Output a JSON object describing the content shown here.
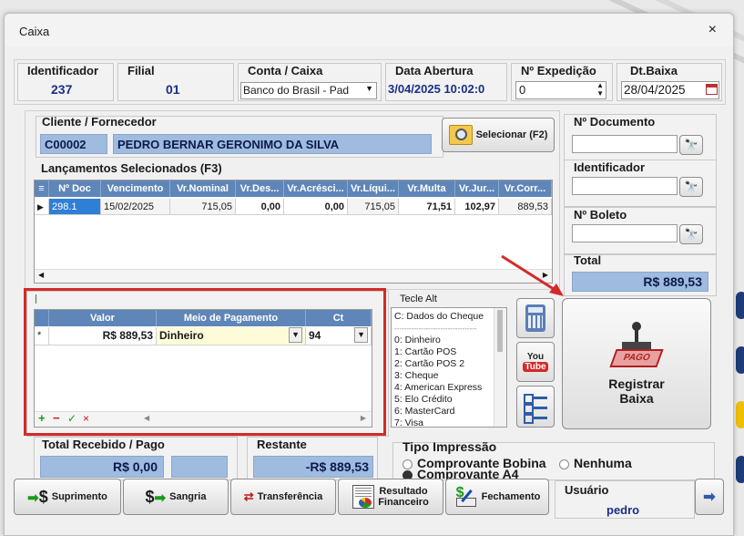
{
  "window": {
    "title": "Caixa",
    "close_glyph": "×"
  },
  "header": {
    "identificador": {
      "label": "Identificador",
      "value": "237"
    },
    "filial": {
      "label": "Filial",
      "value": "01"
    },
    "conta_caixa": {
      "label": "Conta / Caixa",
      "value": "Banco do Brasil - Pad"
    },
    "data_abertura": {
      "label": "Data Abertura",
      "value": "3/04/2025 10:02:0"
    },
    "expedicao": {
      "label": "Nº Expedição",
      "value": "0"
    },
    "dt_baixa": {
      "label": "Dt.Baixa",
      "value": "28/04/2025"
    }
  },
  "cliente": {
    "label": "Cliente / Fornecedor",
    "code": "C00002",
    "name": "PEDRO BERNAR GERONIMO DA SILVA",
    "select_button": "Selecionar (F2)"
  },
  "lancamentos": {
    "label": "Lançamentos Selecionados (F3)",
    "columns": [
      "Nº Doc",
      "Vencimento",
      "Vr.Nominal",
      "Vr.Des...",
      "Vr.Acrésci...",
      "Vr.Líqui...",
      "Vr.Multa",
      "Vr.Jur...",
      "Vr.Corr..."
    ],
    "rows": [
      [
        "298.1",
        "15/02/2025",
        "715,05",
        "0,00",
        "0,00",
        "715,05",
        "71,51",
        "102,97",
        "889,53"
      ]
    ]
  },
  "right_panel": {
    "documento_label": "Nº Documento",
    "identificador_label": "Identificador",
    "boleto_label": "Nº Boleto",
    "total_label": "Total",
    "total_value": "R$ 889,53"
  },
  "pagamento": {
    "columns": [
      "Valor",
      "Meio de Pagamento",
      "Ct"
    ],
    "row": {
      "marker": "*",
      "valor": "R$ 889,53",
      "meio": "Dinheiro",
      "ct": "94"
    },
    "nav": [
      "+",
      "−",
      "✓",
      "×"
    ]
  },
  "tecle_alt": {
    "label": "Tecle Alt",
    "items": [
      "C: Dados do Cheque",
      "----------------------------------",
      "0: Dinheiro",
      "1: Cartão POS",
      "2: Cartão POS 2",
      "3: Cheque",
      "4: American Express",
      "5: Elo Crédito",
      "6: MasterCard",
      "7: Visa"
    ]
  },
  "side_icons": {
    "youtube_top": "You",
    "youtube_bottom": "Tube"
  },
  "registrar": {
    "line1": "Registrar",
    "line2": "Baixa",
    "stamp_text": "PAGO"
  },
  "totais": {
    "recebido_label": "Total Recebido / Pago",
    "recebido_value": "R$ 0,00",
    "restante_label": "Restante",
    "restante_value": "-R$ 889,53"
  },
  "impressao": {
    "label": "Tipo Impressão",
    "opt1": "Comprovante Bobina",
    "opt2": "Nenhuma",
    "opt3": "Comprovante A4"
  },
  "bottom": {
    "suprimento": "Suprimento",
    "sangria": "Sangria",
    "transferencia": "Transferência",
    "resultado1": "Resultado",
    "resultado2": "Financeiro",
    "fechamento": "Fechamento",
    "usuario_label": "Usuário",
    "usuario_value": "pedro"
  },
  "colors": {
    "accent_blue": "#5f86b8",
    "field_blue": "#9fbbe0",
    "highlight_red": "#d42a2a",
    "yellow_field": "#fdfbd8"
  }
}
